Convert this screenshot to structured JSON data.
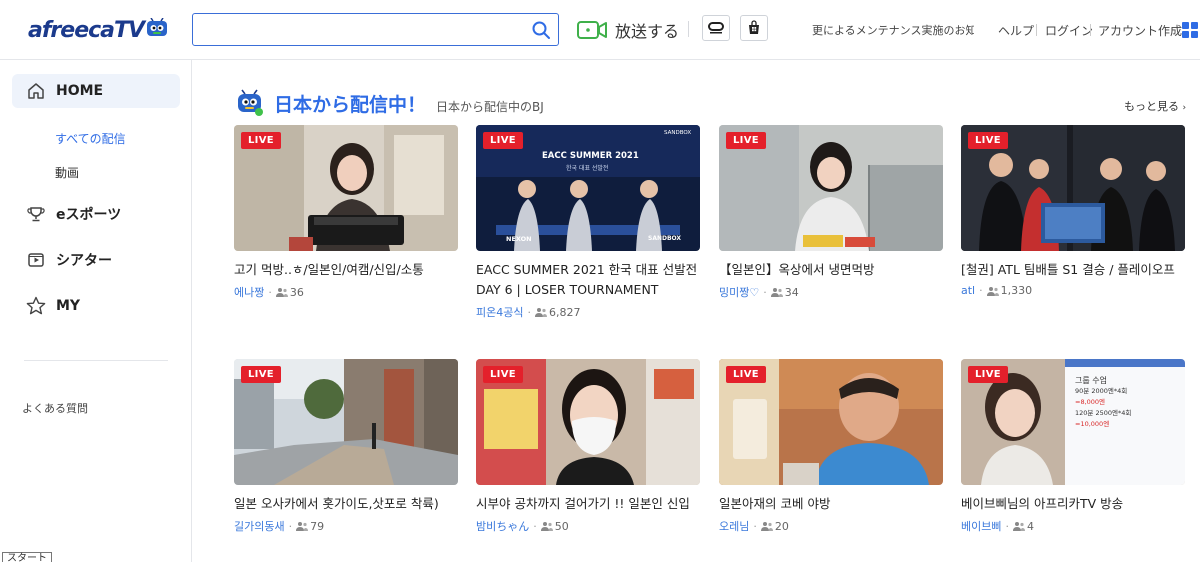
{
  "header": {
    "logo_text": "afreecaTV",
    "search_placeholder": "",
    "broadcast_label": "放送する",
    "notice": "更によるメンテナンス実施のお知らせ",
    "links": [
      "ヘルプ",
      "ログイン",
      "アカウント作成"
    ]
  },
  "sidebar": {
    "items": [
      {
        "label": "HOME",
        "icon": "home-icon"
      },
      {
        "label": "eスポーツ",
        "icon": "trophy-icon"
      },
      {
        "label": "シアター",
        "icon": "theater-icon"
      },
      {
        "label": "MY",
        "icon": "star-icon"
      }
    ],
    "sub_items": [
      "すべての配信",
      "動画"
    ],
    "faq": "よくある質問",
    "tooltip": "スタート"
  },
  "section": {
    "title": "日本から配信中！",
    "subtitle": "日本から配信中のBJ",
    "more": "もっと見る"
  },
  "live_badge": "LIVE",
  "cards": [
    {
      "title": "고기 먹방..ㅎ/일본인/여캠/신입/소통",
      "bj": "에나짱",
      "viewers": "36"
    },
    {
      "title": "EACC SUMMER 2021 한국 대표 선발전 DAY 6 | LOSER TOURNAMENT",
      "bj": "피온4공식",
      "viewers": "6,827"
    },
    {
      "title": "【일본인】옥상에서 냉면먹방",
      "bj": "밍미짱♡",
      "viewers": "34"
    },
    {
      "title": "[철권] ATL 팀배틀 S1 결승 / 플레이오프",
      "bj": "atl",
      "viewers": "1,330"
    },
    {
      "title": "일본 오사카에서 홋가이도,삿포로 착륙)",
      "bj": "길가의동새",
      "viewers": "79"
    },
    {
      "title": "시부야 공차까지 걸어가기 !! 일본인 신입",
      "bj": "밤비ちゃん",
      "viewers": "50"
    },
    {
      "title": "일본아재의 코베 야방",
      "bj": "오레님",
      "viewers": "20"
    },
    {
      "title": "베이브삐님의 아프리카TV 방송",
      "bj": "베이브삐",
      "viewers": "4"
    }
  ],
  "thumb_texts": {
    "eacc_title": "EACC SUMMER 2021",
    "eacc_sub": "한국 대표 선발전",
    "eacc_brand": "SANDBOX",
    "nexon": "NEXON",
    "sandbox": "SANDBOX",
    "price_lines": [
      "그룹 수업",
      "90분 2000엔*4회",
      "=8,000엔",
      "120분 2500엔*4회",
      "=10,000엔"
    ]
  }
}
